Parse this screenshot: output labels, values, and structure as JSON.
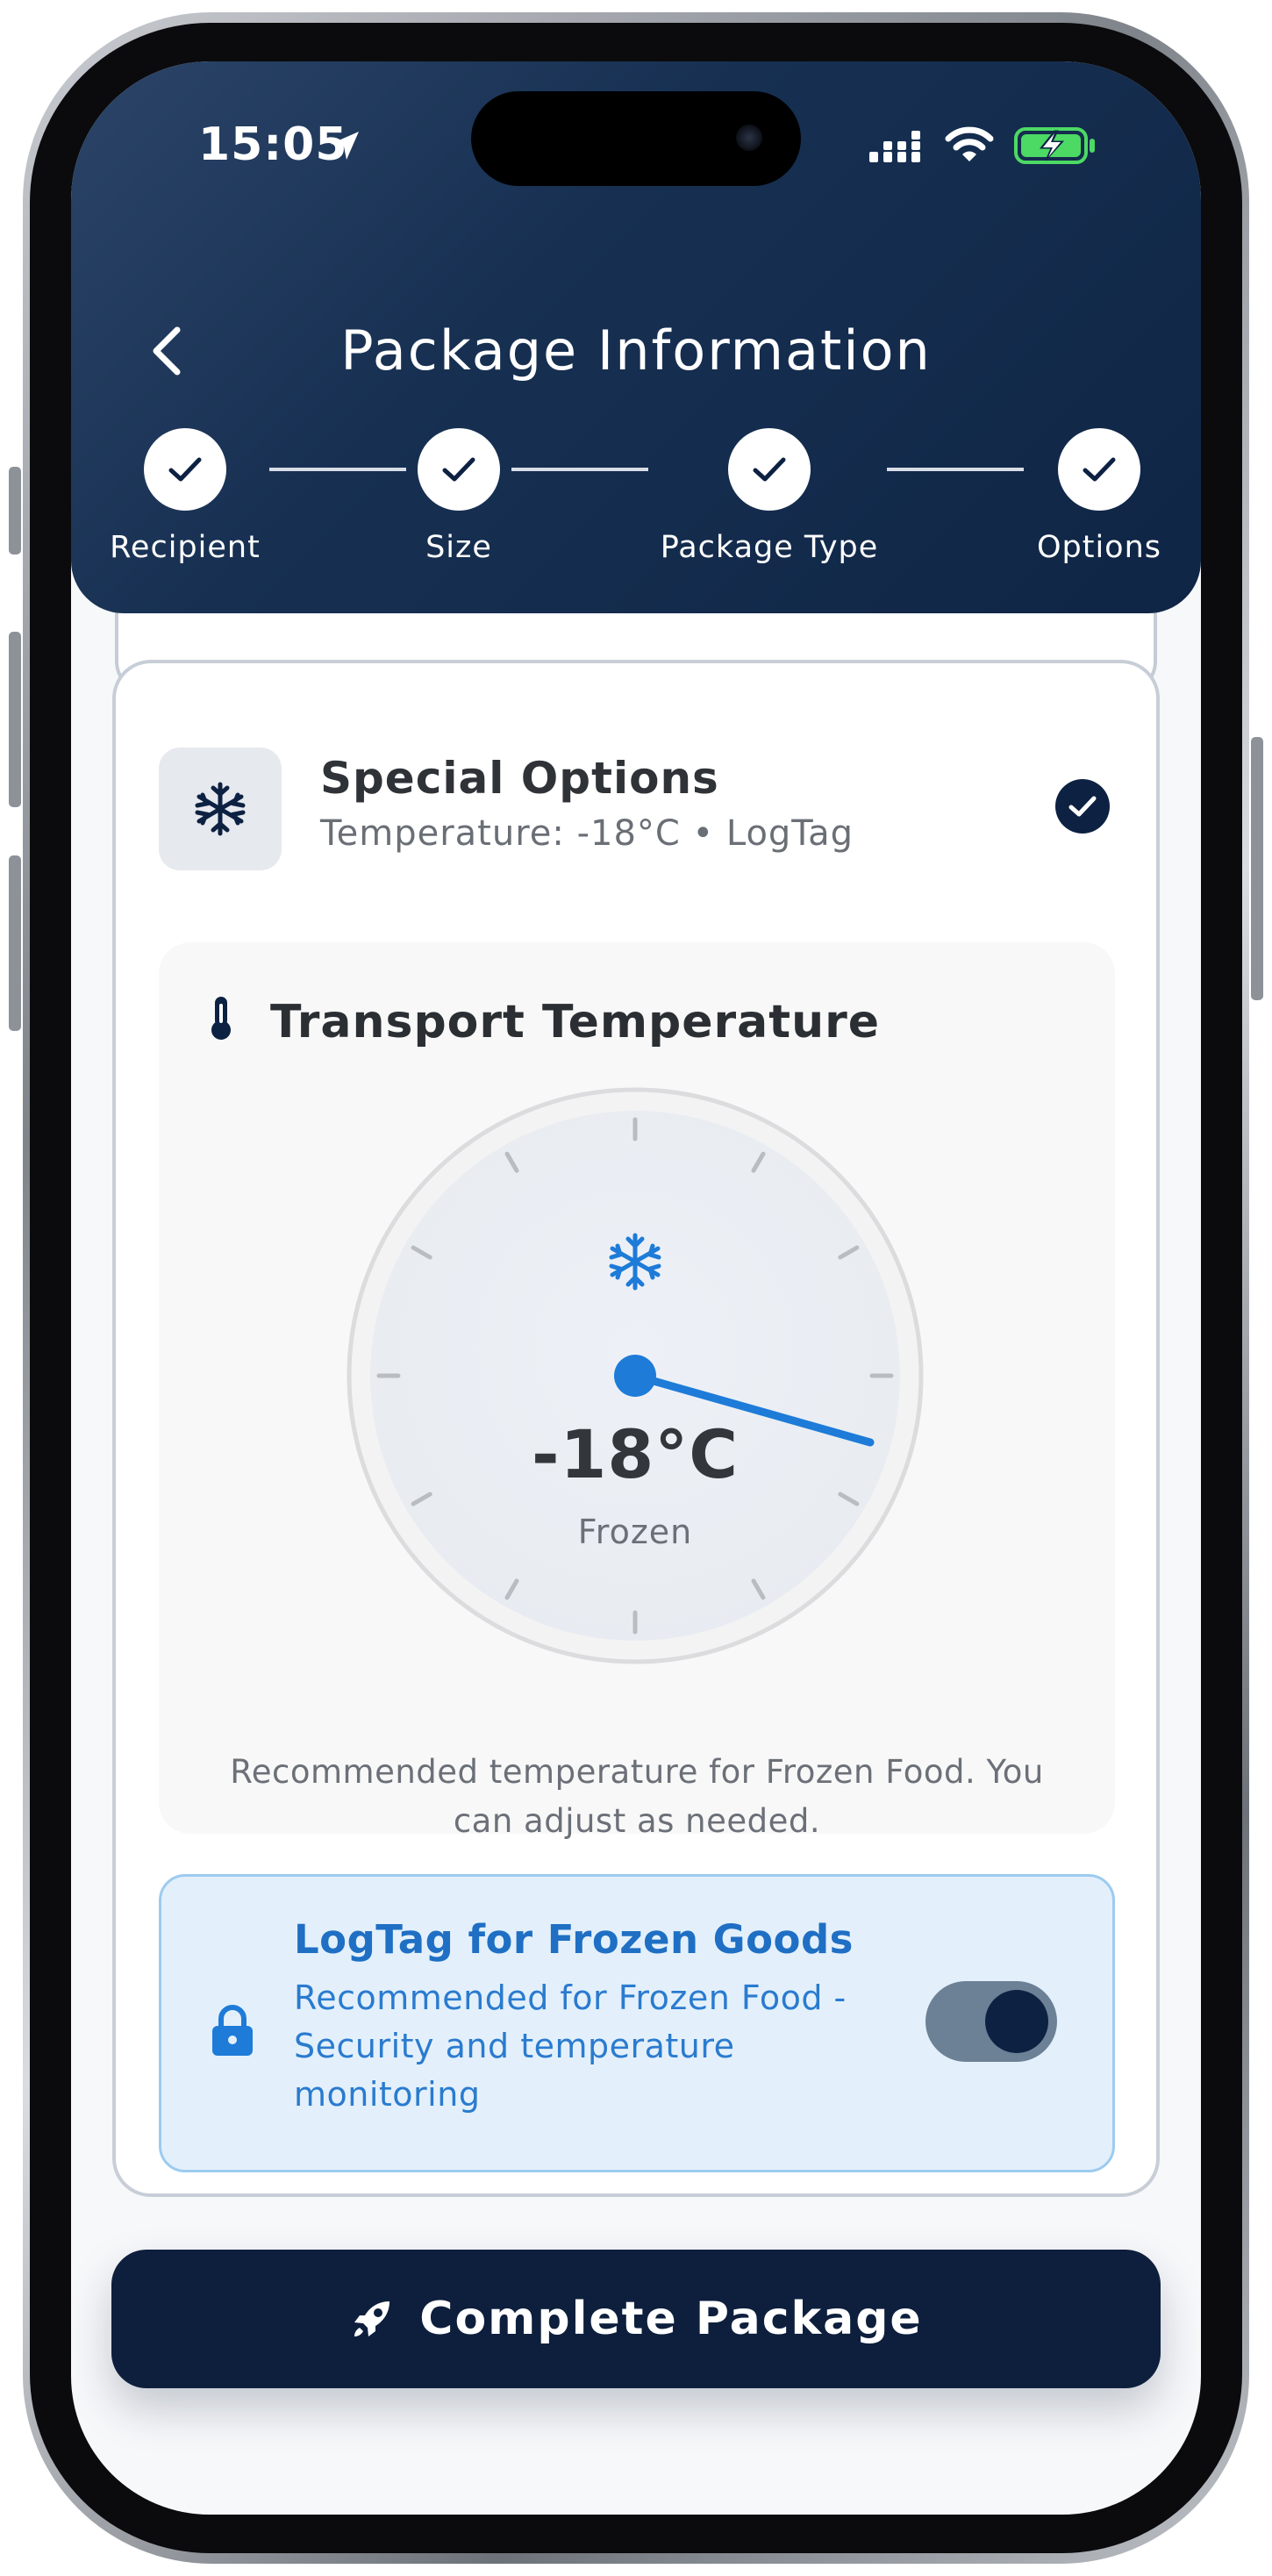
{
  "status_bar": {
    "time": "15:05",
    "icons": [
      "location-arrow-icon",
      "signal-icon",
      "wifi-icon",
      "battery-charging-icon"
    ]
  },
  "header": {
    "title": "Package Information",
    "back_icon": "chevron-left-icon",
    "steps": [
      {
        "label": "Recipient",
        "completed": true
      },
      {
        "label": "Size",
        "completed": true
      },
      {
        "label": "Package Type",
        "completed": true
      },
      {
        "label": "Options",
        "completed": true
      }
    ]
  },
  "special_options": {
    "icon": "snowflake-icon",
    "title": "Special Options",
    "subtitle": "Temperature: -18°C • LogTag",
    "selected": true
  },
  "transport_temperature": {
    "icon": "thermometer-icon",
    "title": "Transport Temperature",
    "value": "-18°C",
    "state": "Frozen",
    "note": "Recommended temperature for Frozen Food. You can adjust as needed."
  },
  "logtag": {
    "icon": "lock-icon",
    "title": "LogTag for Frozen Goods",
    "description": "Recommended for Frozen Food - Security and temperature monitoring",
    "enabled": true
  },
  "footer": {
    "icon": "rocket-icon",
    "button_label": "Complete Package"
  },
  "colors": {
    "header_dark": "#0f2545",
    "accent_blue": "#1e7bd8",
    "button_navy": "#0d1f3d",
    "logtag_bg": "#e3f0fb"
  }
}
